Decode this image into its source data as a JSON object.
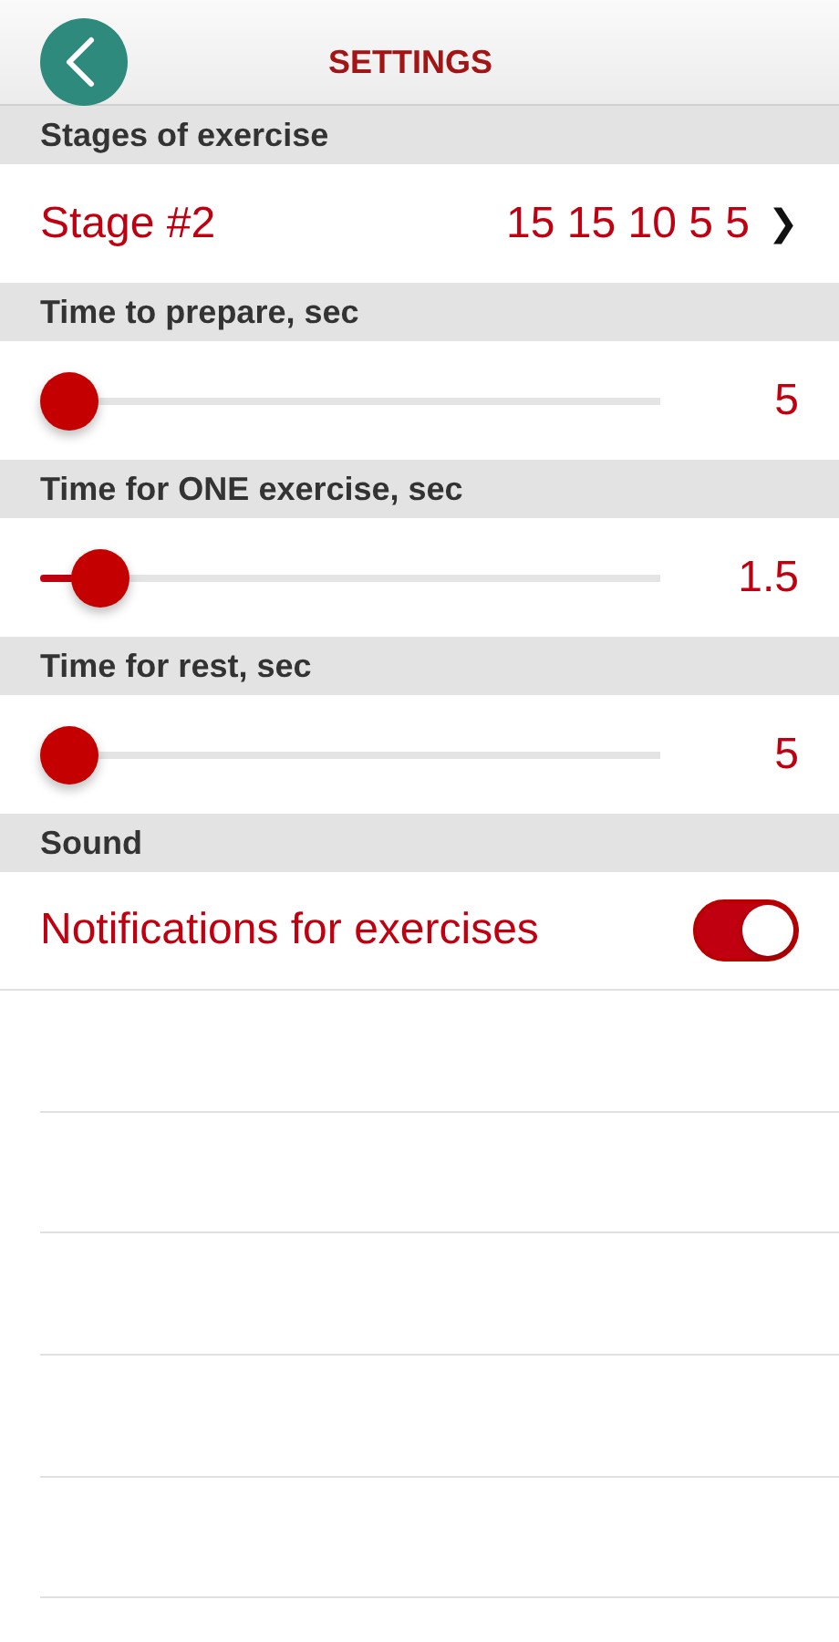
{
  "header": {
    "back_button": true,
    "title": "SETTINGS"
  },
  "sections": [
    {
      "title": "Stages of exercise",
      "kind": "link",
      "label": "Stage #2",
      "value": "15 15 10 5 5",
      "chevron": "❯"
    },
    {
      "title": "Time to prepare, sec",
      "kind": "slider",
      "level": 0,
      "value": "5"
    },
    {
      "title": "Time for ONE exercise, sec",
      "kind": "slider",
      "level": 0.055,
      "value": "1.5"
    },
    {
      "title": "Time for rest, sec",
      "kind": "slider",
      "level": 0,
      "value": "5"
    },
    {
      "title": "Sound",
      "kind": "toggle",
      "label": "Notifications for exercises",
      "on": true
    }
  ]
}
